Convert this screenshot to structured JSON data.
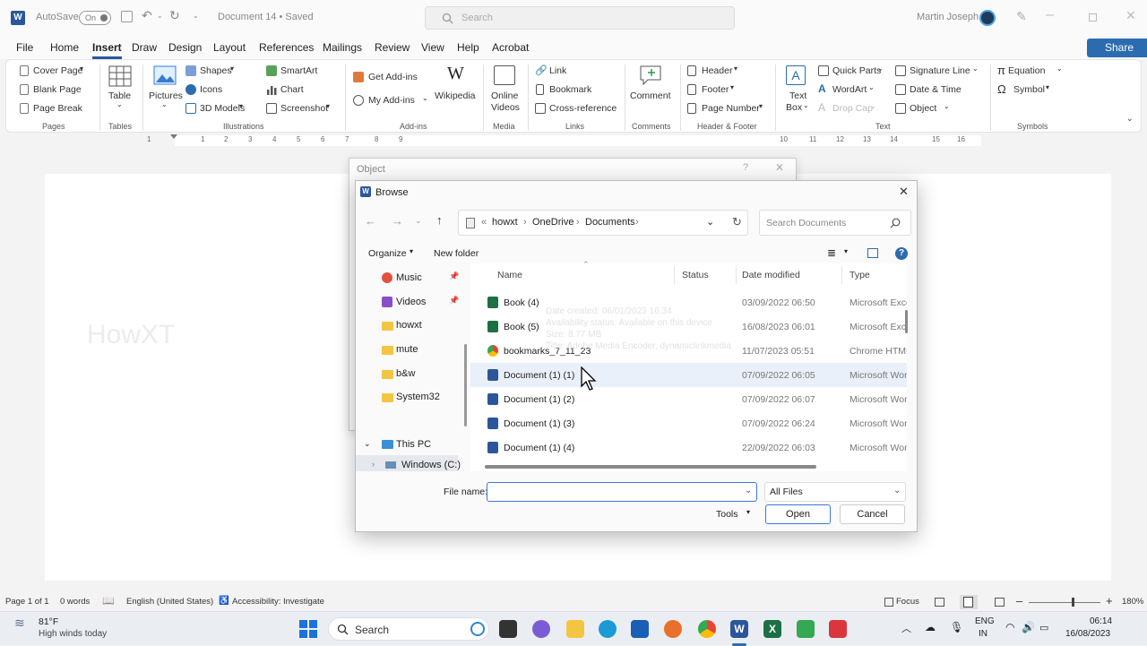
{
  "titlebar": {
    "autosave_label": "AutoSave",
    "autosave_state": "On",
    "doc_title": "Document 14 • Saved",
    "search_placeholder": "Search",
    "user_name": "Martin Joseph"
  },
  "menu": {
    "items": [
      "File",
      "Home",
      "Insert",
      "Draw",
      "Design",
      "Layout",
      "References",
      "Mailings",
      "Review",
      "View",
      "Help",
      "Acrobat"
    ],
    "active": "Insert",
    "share_label": "Share"
  },
  "ribbon": {
    "pages": {
      "cover_page": "Cover Page",
      "blank_page": "Blank Page",
      "page_break": "Page Break",
      "label": "Pages"
    },
    "tables": {
      "table": "Table",
      "label": "Tables"
    },
    "illustrations": {
      "pictures": "Pictures",
      "shapes": "Shapes",
      "icons": "Icons",
      "models": "3D Models",
      "smartart": "SmartArt",
      "chart": "Chart",
      "screenshot": "Screenshot",
      "label": "Illustrations"
    },
    "addins": {
      "get": "Get Add-ins",
      "my": "My Add-ins",
      "wikipedia": "Wikipedia",
      "label": "Add-ins"
    },
    "media": {
      "online_videos_1": "Online",
      "online_videos_2": "Videos",
      "label": "Media"
    },
    "links": {
      "link": "Link",
      "bookmark": "Bookmark",
      "crossref": "Cross-reference",
      "label": "Links"
    },
    "comments": {
      "comment": "Comment",
      "label": "Comments"
    },
    "header_footer": {
      "header": "Header",
      "footer": "Footer",
      "page_number": "Page Number",
      "label": "Header & Footer"
    },
    "text": {
      "text_box_1": "Text",
      "text_box_2": "Box",
      "quick_parts": "Quick Parts",
      "wordart": "WordArt",
      "drop_cap": "Drop Cap",
      "signature": "Signature Line",
      "datetime": "Date & Time",
      "object": "Object",
      "label": "Text"
    },
    "symbols": {
      "equation": "Equation",
      "symbol": "Symbol",
      "label": "Symbols"
    }
  },
  "ruler": {
    "numbers": [
      "1",
      "1",
      "2",
      "3",
      "4",
      "5",
      "6",
      "7",
      "8",
      "9",
      "10",
      "11",
      "12",
      "13",
      "14",
      "15",
      "16"
    ]
  },
  "document": {
    "watermark": "HowXT"
  },
  "object_dialog": {
    "title": "Object"
  },
  "browse": {
    "title": "Browse",
    "path": [
      "howxt",
      "OneDrive",
      "Documents"
    ],
    "search_placeholder": "Search Documents",
    "organize": "Organize",
    "new_folder": "New folder",
    "nav": [
      "Music",
      "Videos",
      "howxt",
      "mute",
      "b&w",
      "System32",
      "This PC",
      "Windows (C:)"
    ],
    "columns": {
      "name": "Name",
      "status": "Status",
      "date": "Date modified",
      "type": "Type"
    },
    "files": [
      {
        "name": "Book (4)",
        "date": "03/09/2022 06:50",
        "type": "Microsoft Exce",
        "kind": "excel"
      },
      {
        "name": "Book (5)",
        "date": "16/08/2023 06:01",
        "type": "Microsoft Exce",
        "kind": "excel"
      },
      {
        "name": "bookmarks_7_11_23",
        "date": "11/07/2023 05:51",
        "type": "Chrome HTML",
        "kind": "chrome"
      },
      {
        "name": "Document (1) (1)",
        "date": "07/09/2022 06:05",
        "type": "Microsoft Wor",
        "kind": "word"
      },
      {
        "name": "Document (1) (2)",
        "date": "07/09/2022 06:07",
        "type": "Microsoft Wor",
        "kind": "word"
      },
      {
        "name": "Document (1) (3)",
        "date": "07/09/2022 06:24",
        "type": "Microsoft Wor",
        "kind": "word"
      },
      {
        "name": "Document (1) (4)",
        "date": "22/09/2022 06:03",
        "type": "Microsoft Wor",
        "kind": "word"
      }
    ],
    "tooltip": [
      "Date created: 06/01/2023 16:34",
      "Availability status: Available on this device",
      "Size: 8.77 MB",
      "Title: Adobe Media Encoder, dynamiclinkmedia"
    ],
    "file_name_label": "File name:",
    "file_name_value": "",
    "filter": "All Files",
    "tools": "Tools",
    "open": "Open",
    "cancel": "Cancel"
  },
  "statusbar": {
    "page": "Page 1 of 1",
    "words": "0 words",
    "language": "English (United States)",
    "accessibility": "Accessibility: Investigate",
    "focus": "Focus",
    "zoom": "180%"
  },
  "taskbar": {
    "weather_temp": "81°F",
    "weather_desc": "High winds today",
    "search": "Search",
    "lang_1": "ENG",
    "lang_2": "IN",
    "time": "06:14",
    "date": "16/08/2023"
  },
  "colors": {
    "word_blue": "#2b579a",
    "share_blue": "#2b6cb0",
    "excel_green": "#1d7044",
    "selection": "#e9f0fa"
  }
}
